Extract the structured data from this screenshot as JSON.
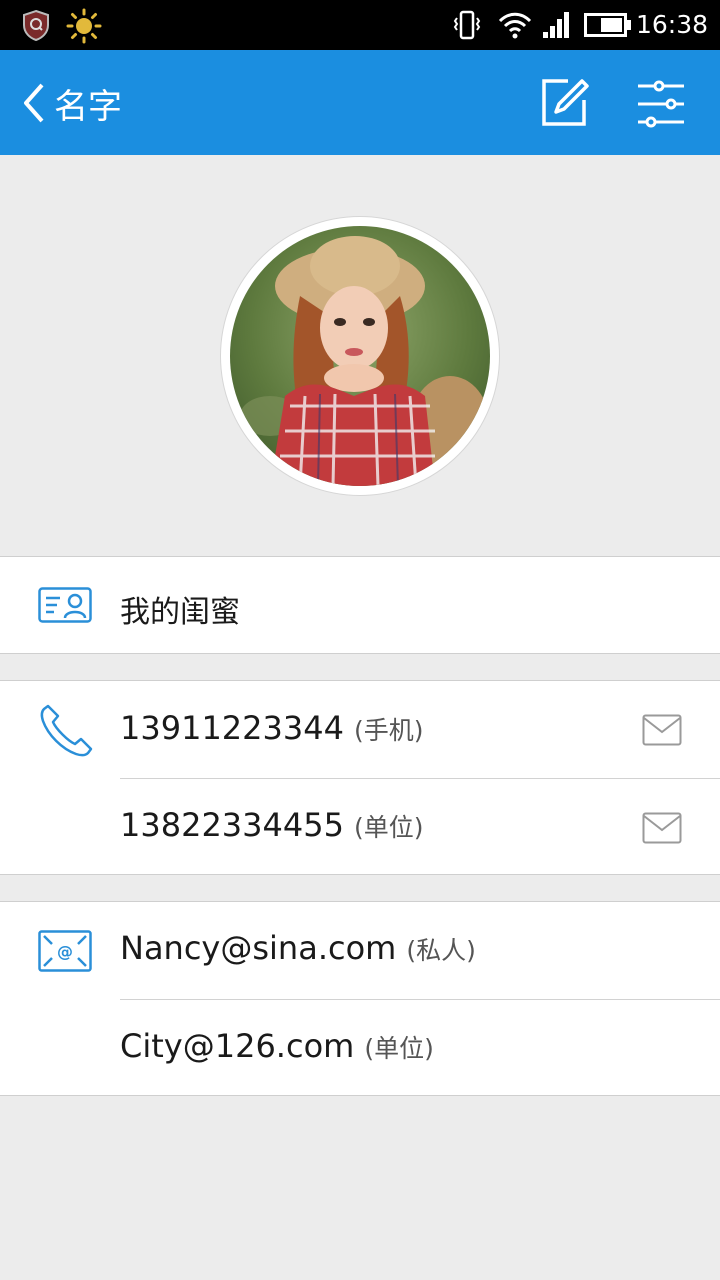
{
  "status_bar": {
    "time": "16:38",
    "icons": [
      "security-shield-icon",
      "sun-icon",
      "vibrate-icon",
      "wifi-icon",
      "signal-icon",
      "battery-icon"
    ]
  },
  "app_bar": {
    "title": "名字",
    "background": "#1b8ee0",
    "icons": [
      "back-chevron-icon",
      "edit-icon",
      "filter-settings-icon"
    ]
  },
  "contact": {
    "group": "我的闺蜜",
    "phones": [
      {
        "number": "13911223344",
        "label": "(手机)"
      },
      {
        "number": "13822334455",
        "label": "(单位)"
      }
    ],
    "emails": [
      {
        "address": "Nancy@sina.com",
        "label": "(私人)"
      },
      {
        "address": "City@126.com",
        "label": "(单位)"
      }
    ]
  },
  "colors": {
    "accent": "#1b8ee0",
    "icon_blue": "#2a8fd8",
    "background": "#ececec"
  }
}
